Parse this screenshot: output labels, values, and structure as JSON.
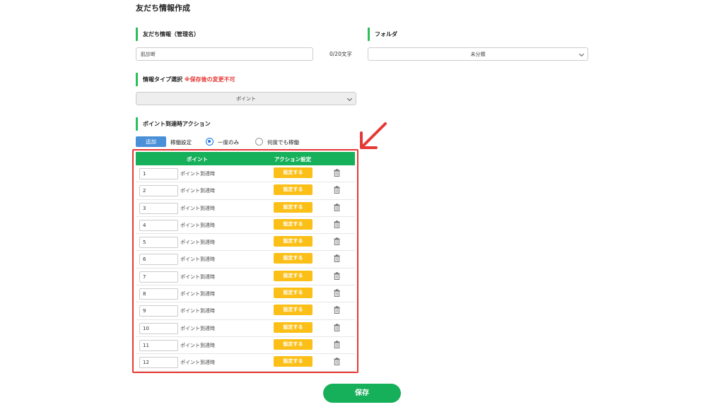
{
  "page_title": "友だち情報作成",
  "name_section": {
    "label": "友だち情報（管理名）",
    "value": "肌診断",
    "char_count": "0/20文字"
  },
  "folder_section": {
    "label": "フォルダ",
    "selected": "未分類"
  },
  "type_section": {
    "label": "情報タイプ選択",
    "note": "※保存後の変更不可",
    "selected": "ポイント"
  },
  "action_section": {
    "label": "ポイント到達時アクション",
    "add_label": "追加",
    "run_setting_label": "稼働設定",
    "options": [
      {
        "label": "一度のみ",
        "selected": true
      },
      {
        "label": "何度でも稼働",
        "selected": false
      }
    ]
  },
  "table": {
    "headers": [
      "ポイント",
      "アクション設定"
    ],
    "reach_text": "ポイント到達時",
    "button_label": "設定する",
    "rows": [
      "1",
      "2",
      "3",
      "4",
      "5",
      "6",
      "7",
      "8",
      "9",
      "10",
      "11",
      "12"
    ]
  },
  "save_label": "保存",
  "colors": {
    "accent_green": "#16b05a",
    "highlight_red": "#e53935",
    "button_yellow": "#fbbf17",
    "add_blue": "#4a90d9"
  }
}
